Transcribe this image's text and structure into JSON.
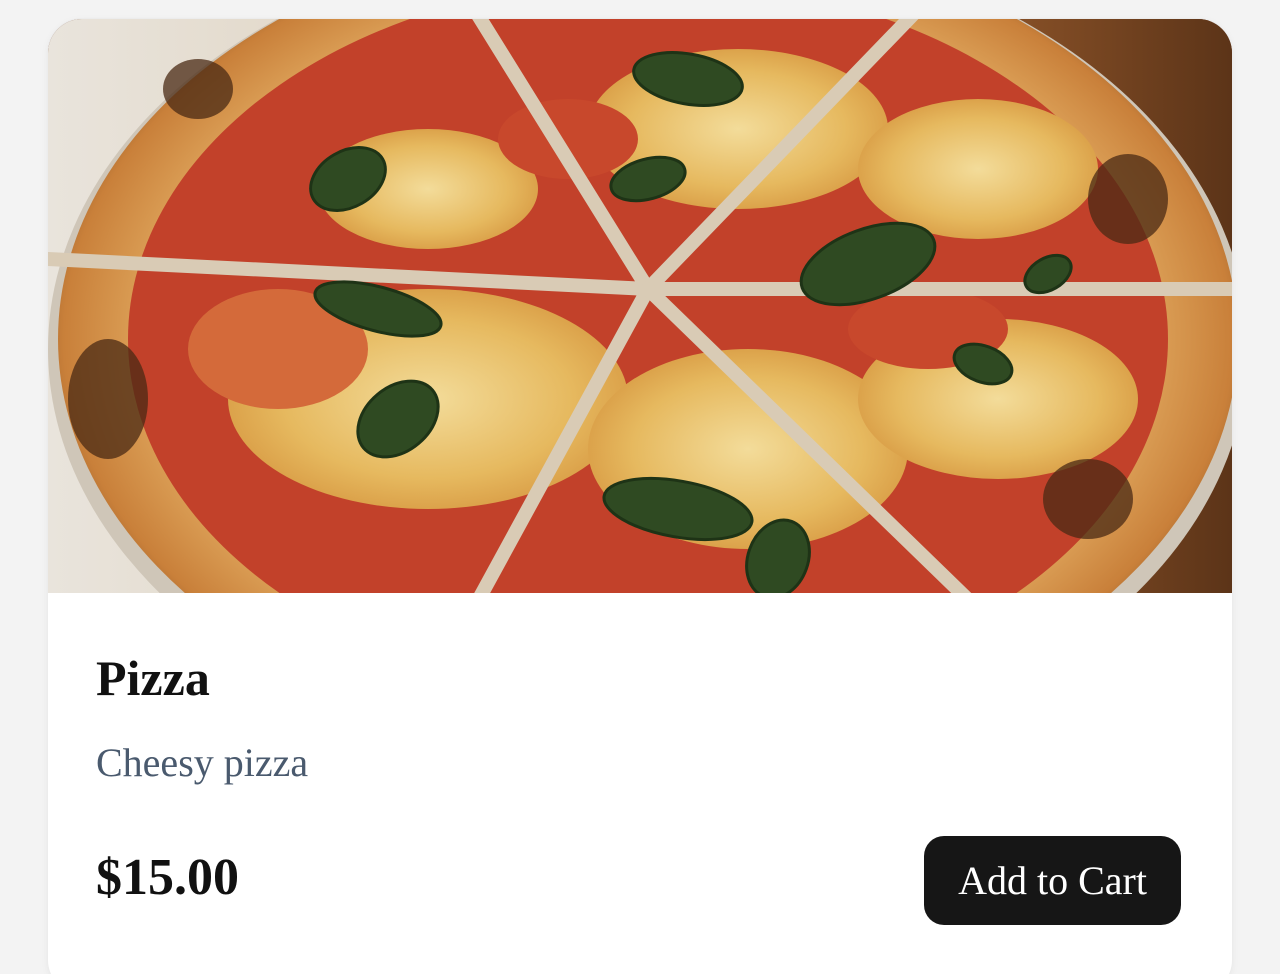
{
  "product": {
    "image_alt": "Pizza",
    "title": "Pizza",
    "description": "Cheesy pizza",
    "price": "$15.00",
    "add_to_cart_label": "Add to Cart"
  },
  "colors": {
    "button_background": "#161616",
    "description_text": "#4a5a6e",
    "card_background": "#ffffff"
  }
}
